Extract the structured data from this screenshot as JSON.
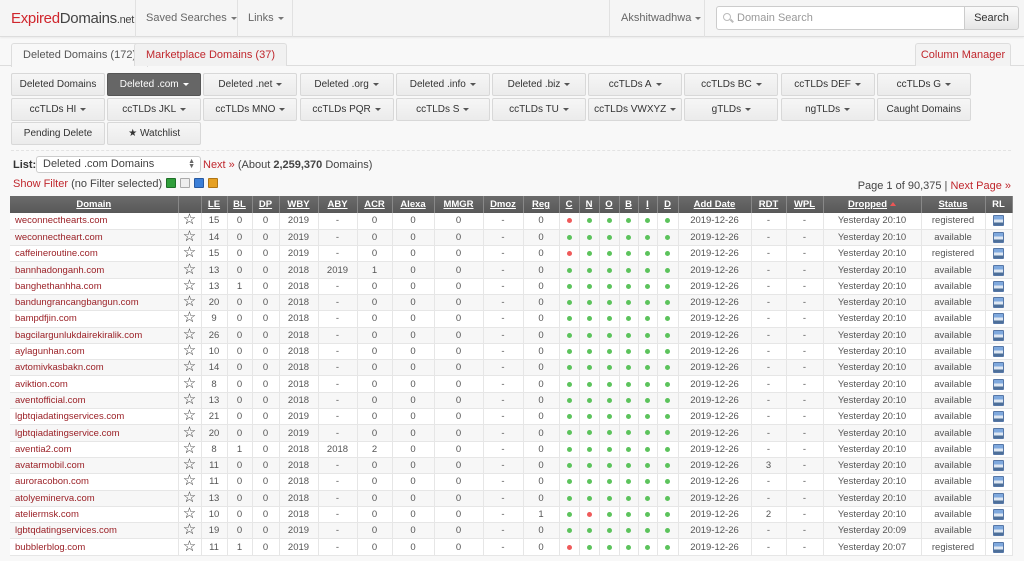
{
  "navbar": {
    "brand_red": "Expired",
    "brand_dark": "Domains",
    "brand_suffix": ".net",
    "saved_searches": "Saved Searches",
    "links": "Links",
    "user": "Akshitwadhwa",
    "search_placeholder": "Domain Search",
    "search_button": "Search"
  },
  "tabs": [
    {
      "label": "Deleted Domains (172)",
      "active": true
    },
    {
      "label": "Marketplace Domains (37)",
      "active": false
    }
  ],
  "column_manager": "Column Manager",
  "category_buttons": [
    {
      "label": "Deleted Domains",
      "caret": false,
      "active": false
    },
    {
      "label": "Deleted .com",
      "caret": true,
      "active": true
    },
    {
      "label": "Deleted .net",
      "caret": true,
      "active": false
    },
    {
      "label": "Deleted .org",
      "caret": true,
      "active": false
    },
    {
      "label": "Deleted .info",
      "caret": true,
      "active": false
    },
    {
      "label": "Deleted .biz",
      "caret": true,
      "active": false
    },
    {
      "label": "ccTLDs A",
      "caret": true,
      "active": false
    },
    {
      "label": "ccTLDs BC",
      "caret": true,
      "active": false
    },
    {
      "label": "ccTLDs DEF",
      "caret": true,
      "active": false
    },
    {
      "label": "ccTLDs G",
      "caret": true,
      "active": false
    },
    {
      "label": "ccTLDs HI",
      "caret": true,
      "active": false
    },
    {
      "label": "ccTLDs JKL",
      "caret": true,
      "active": false
    },
    {
      "label": "ccTLDs MNO",
      "caret": true,
      "active": false
    },
    {
      "label": "ccTLDs PQR",
      "caret": true,
      "active": false
    },
    {
      "label": "ccTLDs S",
      "caret": true,
      "active": false
    },
    {
      "label": "ccTLDs TU",
      "caret": true,
      "active": false
    },
    {
      "label": "ccTLDs VWXYZ",
      "caret": true,
      "active": false
    },
    {
      "label": "gTLDs",
      "caret": true,
      "active": false
    },
    {
      "label": "ngTLDs",
      "caret": true,
      "active": false
    },
    {
      "label": "Caught Domains",
      "caret": false,
      "active": false
    },
    {
      "label": "Pending Delete",
      "caret": false,
      "active": false
    },
    {
      "label": "★ Watchlist",
      "caret": false,
      "active": false
    }
  ],
  "list": {
    "label": "List:",
    "selected": "Deleted .com Domains",
    "next": "Next »",
    "about_prefix": "(About ",
    "count": "2,259,370",
    "about_suffix": " Domains)"
  },
  "filter": {
    "show_filter": "Show Filter",
    "status": "(no Filter selected)",
    "icons": [
      "export-csv-icon",
      "document-icon",
      "save-icon",
      "clipboard-icon"
    ]
  },
  "pager": {
    "text": "Page 1 of 90,375 | ",
    "next_page": "Next Page »"
  },
  "table": {
    "columns": [
      "Domain",
      "",
      "LE",
      "BL",
      "DP",
      "WBY",
      "ABY",
      "ACR",
      "Alexa",
      "MMGR",
      "Dmoz",
      "Reg",
      "C",
      "N",
      "O",
      "B",
      "I",
      "D",
      "Add Date",
      "RDT",
      "WPL",
      "Dropped",
      "Status",
      "RL"
    ],
    "sorted_column": "Dropped",
    "rows": [
      {
        "domain": "weconnecthearts.com",
        "le": "15",
        "bl": "0",
        "dp": "0",
        "wby": "2019",
        "aby": "-",
        "acr": "0",
        "alexa": "0",
        "mmgr": "0",
        "dmoz": "-",
        "reg": "0",
        "c": "red",
        "n": "green",
        "o": "green",
        "b": "green",
        "i": "green",
        "d": "green",
        "add_date": "2019-12-26",
        "rdt": "-",
        "wpl": "-",
        "dropped": "Yesterday 20:10",
        "status": "registered"
      },
      {
        "domain": "weconnectheart.com",
        "le": "14",
        "bl": "0",
        "dp": "0",
        "wby": "2019",
        "aby": "-",
        "acr": "0",
        "alexa": "0",
        "mmgr": "0",
        "dmoz": "-",
        "reg": "0",
        "c": "green",
        "n": "green",
        "o": "green",
        "b": "green",
        "i": "green",
        "d": "green",
        "add_date": "2019-12-26",
        "rdt": "-",
        "wpl": "-",
        "dropped": "Yesterday 20:10",
        "status": "available"
      },
      {
        "domain": "caffeineroutine.com",
        "le": "15",
        "bl": "0",
        "dp": "0",
        "wby": "2019",
        "aby": "-",
        "acr": "0",
        "alexa": "0",
        "mmgr": "0",
        "dmoz": "-",
        "reg": "0",
        "c": "red",
        "n": "green",
        "o": "green",
        "b": "green",
        "i": "green",
        "d": "green",
        "add_date": "2019-12-26",
        "rdt": "-",
        "wpl": "-",
        "dropped": "Yesterday 20:10",
        "status": "registered"
      },
      {
        "domain": "bannhadonganh.com",
        "le": "13",
        "bl": "0",
        "dp": "0",
        "wby": "2018",
        "aby": "2019",
        "acr": "1",
        "alexa": "0",
        "mmgr": "0",
        "dmoz": "-",
        "reg": "0",
        "c": "green",
        "n": "green",
        "o": "green",
        "b": "green",
        "i": "green",
        "d": "green",
        "add_date": "2019-12-26",
        "rdt": "-",
        "wpl": "-",
        "dropped": "Yesterday 20:10",
        "status": "available"
      },
      {
        "domain": "banghethanhha.com",
        "le": "13",
        "bl": "1",
        "dp": "0",
        "wby": "2018",
        "aby": "-",
        "acr": "0",
        "alexa": "0",
        "mmgr": "0",
        "dmoz": "-",
        "reg": "0",
        "c": "green",
        "n": "green",
        "o": "green",
        "b": "green",
        "i": "green",
        "d": "green",
        "add_date": "2019-12-26",
        "rdt": "-",
        "wpl": "-",
        "dropped": "Yesterday 20:10",
        "status": "available"
      },
      {
        "domain": "bandungrancangbangun.com",
        "le": "20",
        "bl": "0",
        "dp": "0",
        "wby": "2018",
        "aby": "-",
        "acr": "0",
        "alexa": "0",
        "mmgr": "0",
        "dmoz": "-",
        "reg": "0",
        "c": "green",
        "n": "green",
        "o": "green",
        "b": "green",
        "i": "green",
        "d": "green",
        "add_date": "2019-12-26",
        "rdt": "-",
        "wpl": "-",
        "dropped": "Yesterday 20:10",
        "status": "available"
      },
      {
        "domain": "bampdfjin.com",
        "le": "9",
        "bl": "0",
        "dp": "0",
        "wby": "2018",
        "aby": "-",
        "acr": "0",
        "alexa": "0",
        "mmgr": "0",
        "dmoz": "-",
        "reg": "0",
        "c": "green",
        "n": "green",
        "o": "green",
        "b": "green",
        "i": "green",
        "d": "green",
        "add_date": "2019-12-26",
        "rdt": "-",
        "wpl": "-",
        "dropped": "Yesterday 20:10",
        "status": "available"
      },
      {
        "domain": "bagcilargunlukdairekiralik.com",
        "le": "26",
        "bl": "0",
        "dp": "0",
        "wby": "2018",
        "aby": "-",
        "acr": "0",
        "alexa": "0",
        "mmgr": "0",
        "dmoz": "-",
        "reg": "0",
        "c": "green",
        "n": "green",
        "o": "green",
        "b": "green",
        "i": "green",
        "d": "green",
        "add_date": "2019-12-26",
        "rdt": "-",
        "wpl": "-",
        "dropped": "Yesterday 20:10",
        "status": "available"
      },
      {
        "domain": "aylagunhan.com",
        "le": "10",
        "bl": "0",
        "dp": "0",
        "wby": "2018",
        "aby": "-",
        "acr": "0",
        "alexa": "0",
        "mmgr": "0",
        "dmoz": "-",
        "reg": "0",
        "c": "green",
        "n": "green",
        "o": "green",
        "b": "green",
        "i": "green",
        "d": "green",
        "add_date": "2019-12-26",
        "rdt": "-",
        "wpl": "-",
        "dropped": "Yesterday 20:10",
        "status": "available"
      },
      {
        "domain": "avtomivkasbakn.com",
        "le": "14",
        "bl": "0",
        "dp": "0",
        "wby": "2018",
        "aby": "-",
        "acr": "0",
        "alexa": "0",
        "mmgr": "0",
        "dmoz": "-",
        "reg": "0",
        "c": "green",
        "n": "green",
        "o": "green",
        "b": "green",
        "i": "green",
        "d": "green",
        "add_date": "2019-12-26",
        "rdt": "-",
        "wpl": "-",
        "dropped": "Yesterday 20:10",
        "status": "available"
      },
      {
        "domain": "aviktion.com",
        "le": "8",
        "bl": "0",
        "dp": "0",
        "wby": "2018",
        "aby": "-",
        "acr": "0",
        "alexa": "0",
        "mmgr": "0",
        "dmoz": "-",
        "reg": "0",
        "c": "green",
        "n": "green",
        "o": "green",
        "b": "green",
        "i": "green",
        "d": "green",
        "add_date": "2019-12-26",
        "rdt": "-",
        "wpl": "-",
        "dropped": "Yesterday 20:10",
        "status": "available"
      },
      {
        "domain": "aventofficial.com",
        "le": "13",
        "bl": "0",
        "dp": "0",
        "wby": "2018",
        "aby": "-",
        "acr": "0",
        "alexa": "0",
        "mmgr": "0",
        "dmoz": "-",
        "reg": "0",
        "c": "green",
        "n": "green",
        "o": "green",
        "b": "green",
        "i": "green",
        "d": "green",
        "add_date": "2019-12-26",
        "rdt": "-",
        "wpl": "-",
        "dropped": "Yesterday 20:10",
        "status": "available"
      },
      {
        "domain": "lgbtqiadatingservices.com",
        "le": "21",
        "bl": "0",
        "dp": "0",
        "wby": "2019",
        "aby": "-",
        "acr": "0",
        "alexa": "0",
        "mmgr": "0",
        "dmoz": "-",
        "reg": "0",
        "c": "green",
        "n": "green",
        "o": "green",
        "b": "green",
        "i": "green",
        "d": "green",
        "add_date": "2019-12-26",
        "rdt": "-",
        "wpl": "-",
        "dropped": "Yesterday 20:10",
        "status": "available"
      },
      {
        "domain": "lgbtqiadatingservice.com",
        "le": "20",
        "bl": "0",
        "dp": "0",
        "wby": "2019",
        "aby": "-",
        "acr": "0",
        "alexa": "0",
        "mmgr": "0",
        "dmoz": "-",
        "reg": "0",
        "c": "green",
        "n": "green",
        "o": "green",
        "b": "green",
        "i": "green",
        "d": "green",
        "add_date": "2019-12-26",
        "rdt": "-",
        "wpl": "-",
        "dropped": "Yesterday 20:10",
        "status": "available"
      },
      {
        "domain": "aventia2.com",
        "le": "8",
        "bl": "1",
        "dp": "0",
        "wby": "2018",
        "aby": "2018",
        "acr": "2",
        "alexa": "0",
        "mmgr": "0",
        "dmoz": "-",
        "reg": "0",
        "c": "green",
        "n": "green",
        "o": "green",
        "b": "green",
        "i": "green",
        "d": "green",
        "add_date": "2019-12-26",
        "rdt": "-",
        "wpl": "-",
        "dropped": "Yesterday 20:10",
        "status": "available"
      },
      {
        "domain": "avatarmobil.com",
        "le": "11",
        "bl": "0",
        "dp": "0",
        "wby": "2018",
        "aby": "-",
        "acr": "0",
        "alexa": "0",
        "mmgr": "0",
        "dmoz": "-",
        "reg": "0",
        "c": "green",
        "n": "green",
        "o": "green",
        "b": "green",
        "i": "green",
        "d": "green",
        "add_date": "2019-12-26",
        "rdt": "3",
        "wpl": "-",
        "dropped": "Yesterday 20:10",
        "status": "available"
      },
      {
        "domain": "auroracobon.com",
        "le": "11",
        "bl": "0",
        "dp": "0",
        "wby": "2018",
        "aby": "-",
        "acr": "0",
        "alexa": "0",
        "mmgr": "0",
        "dmoz": "-",
        "reg": "0",
        "c": "green",
        "n": "green",
        "o": "green",
        "b": "green",
        "i": "green",
        "d": "green",
        "add_date": "2019-12-26",
        "rdt": "-",
        "wpl": "-",
        "dropped": "Yesterday 20:10",
        "status": "available"
      },
      {
        "domain": "atolyeminerva.com",
        "le": "13",
        "bl": "0",
        "dp": "0",
        "wby": "2018",
        "aby": "-",
        "acr": "0",
        "alexa": "0",
        "mmgr": "0",
        "dmoz": "-",
        "reg": "0",
        "c": "green",
        "n": "green",
        "o": "green",
        "b": "green",
        "i": "green",
        "d": "green",
        "add_date": "2019-12-26",
        "rdt": "-",
        "wpl": "-",
        "dropped": "Yesterday 20:10",
        "status": "available"
      },
      {
        "domain": "ateliermsk.com",
        "le": "10",
        "bl": "0",
        "dp": "0",
        "wby": "2018",
        "aby": "-",
        "acr": "0",
        "alexa": "0",
        "mmgr": "0",
        "dmoz": "-",
        "reg": "1",
        "c": "green",
        "n": "red",
        "o": "green",
        "b": "green",
        "i": "green",
        "d": "green",
        "add_date": "2019-12-26",
        "rdt": "2",
        "wpl": "-",
        "dropped": "Yesterday 20:10",
        "status": "available"
      },
      {
        "domain": "lgbtqdatingservices.com",
        "le": "19",
        "bl": "0",
        "dp": "0",
        "wby": "2019",
        "aby": "-",
        "acr": "0",
        "alexa": "0",
        "mmgr": "0",
        "dmoz": "-",
        "reg": "0",
        "c": "green",
        "n": "green",
        "o": "green",
        "b": "green",
        "i": "green",
        "d": "green",
        "add_date": "2019-12-26",
        "rdt": "-",
        "wpl": "-",
        "dropped": "Yesterday 20:09",
        "status": "available"
      },
      {
        "domain": "bubblerblog.com",
        "le": "11",
        "bl": "1",
        "dp": "0",
        "wby": "2019",
        "aby": "-",
        "acr": "0",
        "alexa": "0",
        "mmgr": "0",
        "dmoz": "-",
        "reg": "0",
        "c": "red",
        "n": "green",
        "o": "green",
        "b": "green",
        "i": "green",
        "d": "green",
        "add_date": "2019-12-26",
        "rdt": "-",
        "wpl": "-",
        "dropped": "Yesterday 20:07",
        "status": "registered"
      }
    ]
  }
}
